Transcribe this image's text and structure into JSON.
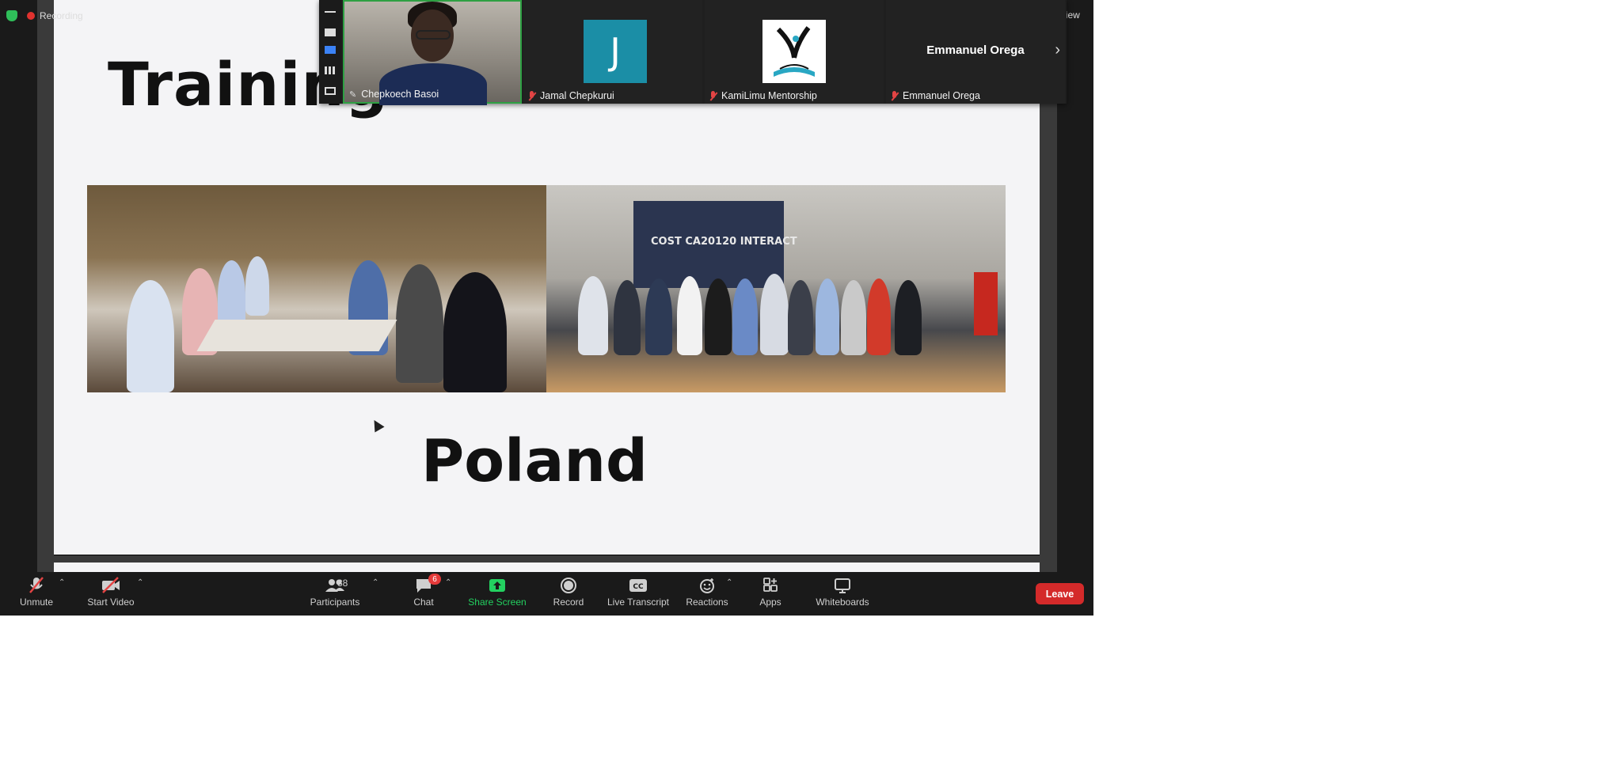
{
  "status": {
    "recording_label": "Recording",
    "view_label": "View"
  },
  "colors": {
    "accent_green": "#23d160",
    "leave_red": "#d42a2a",
    "muted_red": "#e34444",
    "speaker_border": "#2ea043",
    "avatar_teal": "#1b8ea6"
  },
  "slide": {
    "title": "Training",
    "photo_screen_text": "COST CA20120 INTERACT",
    "caption": "Poland"
  },
  "gallery": {
    "participants": [
      {
        "name": "Chepkoech Basoi",
        "icon": "pin-icon"
      },
      {
        "name": "Jamal Chepkurui",
        "avatar_letter": "J",
        "icon": "mic-muted-icon"
      },
      {
        "name": "KamiLimu Mentorship",
        "icon": "mic-muted-icon"
      },
      {
        "name": "Emmanuel Orega",
        "display_name": "Emmanuel Orega",
        "icon": "mic-muted-icon"
      }
    ]
  },
  "toolbar": {
    "unmute": "Unmute",
    "start_video": "Start Video",
    "participants": "Participants",
    "participants_count": "38",
    "chat": "Chat",
    "chat_badge": "6",
    "share_screen": "Share Screen",
    "record": "Record",
    "live_transcript": "Live Transcript",
    "reactions": "Reactions",
    "apps": "Apps",
    "whiteboards": "Whiteboards",
    "leave": "Leave"
  }
}
